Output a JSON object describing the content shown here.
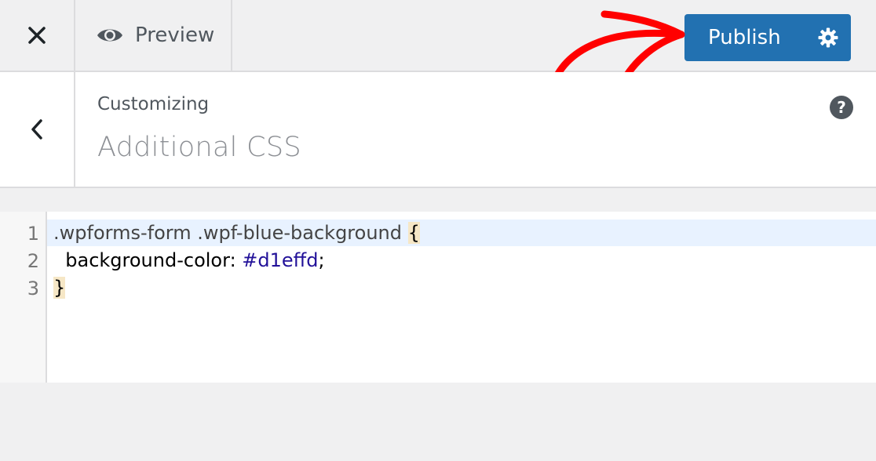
{
  "topbar": {
    "preview_label": "Preview",
    "publish_label": "Publish"
  },
  "section": {
    "breadcrumb": "Customizing",
    "title": "Additional CSS"
  },
  "editor": {
    "line_numbers": [
      "1",
      "2",
      "3"
    ],
    "line1": {
      "selector": ".wpforms-form .wpf-blue-background ",
      "brace": "{"
    },
    "line2": {
      "indent": "  ",
      "property": "background-color",
      "colon": ": ",
      "value": "#d1effd",
      "semicolon": ";"
    },
    "line3": {
      "brace": "}"
    }
  },
  "colors": {
    "publish_bg": "#2271b1",
    "arrow": "#ff0000",
    "active_line": "#e8f2ff",
    "css_value": "#221199"
  }
}
